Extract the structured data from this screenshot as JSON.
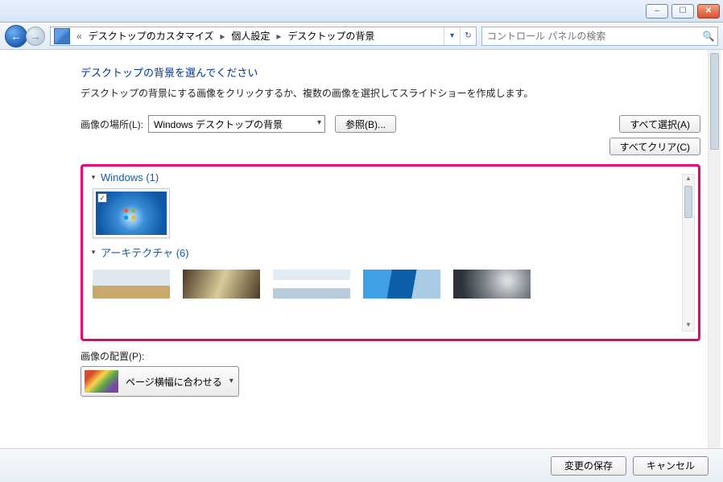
{
  "window": {
    "minimize": "–",
    "maximize": "☐",
    "close": "✕"
  },
  "breadcrumb": {
    "back_separator": "«",
    "items": [
      "デスクトップのカスタマイズ",
      "個人設定",
      "デスクトップの背景"
    ],
    "sep": "▸",
    "dropdown_glyph": "▾",
    "refresh_glyph": "↻"
  },
  "search": {
    "placeholder": "コントロール パネルの検索",
    "icon_glyph": "🔍"
  },
  "heading": "デスクトップの背景を選んでください",
  "subtext": "デスクトップの背景にする画像をクリックするか、複数の画像を選択してスライドショーを作成します。",
  "location": {
    "label": "画像の場所(L):",
    "value": "Windows デスクトップの背景",
    "browse": "参照(B)..."
  },
  "select_all": "すべて選択(A)",
  "clear_all": "すべてクリア(C)",
  "groups": [
    {
      "title": "Windows (1)",
      "toggle": "▾",
      "items": [
        {
          "name": "windows-default",
          "checked": true
        }
      ]
    },
    {
      "title": "アーキテクチャ (6)",
      "toggle": "▾",
      "items": [
        {
          "name": "arch-1"
        },
        {
          "name": "arch-2"
        },
        {
          "name": "arch-3"
        },
        {
          "name": "arch-4"
        },
        {
          "name": "arch-5"
        }
      ]
    }
  ],
  "position": {
    "label": "画像の配置(P):",
    "value": "ページ横幅に合わせる"
  },
  "footer": {
    "save": "変更の保存",
    "cancel": "キャンセル"
  },
  "check_glyph": "✓"
}
